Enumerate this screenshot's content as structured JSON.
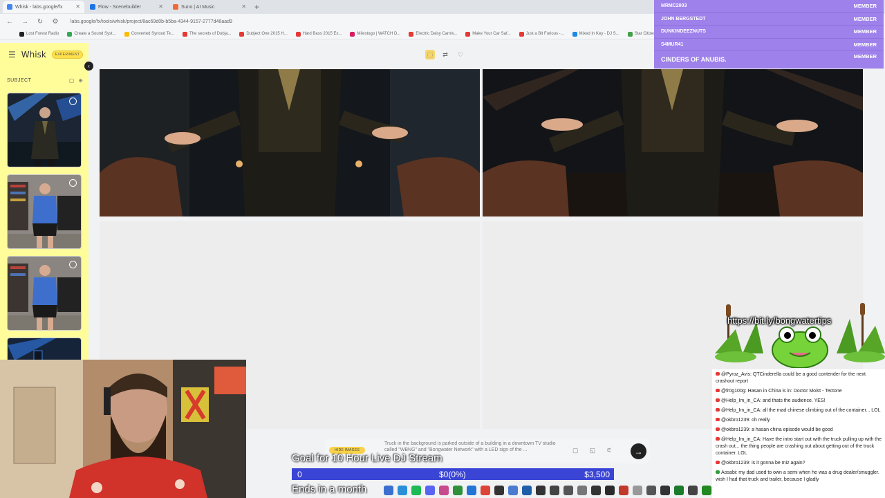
{
  "browser": {
    "tabs": [
      {
        "title": "Whisk - labs.google/fx",
        "color": "#4285f4",
        "active": true
      },
      {
        "title": "Flow - Scenebuilder",
        "color": "#1a73e8",
        "active": false
      },
      {
        "title": "Suno | AI Music",
        "color": "#f06a35",
        "active": false
      }
    ],
    "url": "labs.google/fx/tools/whisk/project/8ac69d0b-b5ba-4344-9157-2777d48aad9",
    "bookmarks": [
      {
        "label": "Lost Forest Radio",
        "color": "#222"
      },
      {
        "label": "Create a Sound Syst...",
        "color": "#34a853"
      },
      {
        "label": "Converted Synced Te...",
        "color": "#fbbc04"
      },
      {
        "label": "The secrets of Dubja...",
        "color": "#e53935"
      },
      {
        "label": "Dubject One 2015 H...",
        "color": "#e53935"
      },
      {
        "label": "Hard Bass 2015 Ex...",
        "color": "#e53935"
      },
      {
        "label": "Milestogo | WATCH D...",
        "color": "#d81b60"
      },
      {
        "label": "Electric Daisy Carniv...",
        "color": "#e53935"
      },
      {
        "label": "Make Your Car Saf...",
        "color": "#e53935"
      },
      {
        "label": "Just a Bit Furious -...",
        "color": "#e53935"
      },
      {
        "label": "Mixed In Key - DJ S...",
        "color": "#1e88e5"
      },
      {
        "label": "Star Citizen - Image...",
        "color": "#43a047"
      }
    ]
  },
  "whisk": {
    "logo": "Whisk",
    "badge": "EXPERIMENT",
    "subject_label": "SUBJECT"
  },
  "prompt": {
    "hide_images": "HIDE IMAGES",
    "text": "Truck in the background is parked outside of a building in a downtown TV studio called \"WBNG\" and \"Bongwater Network\" with a LED sign of the ..."
  },
  "goal": {
    "title": "Goal for 10 Hour Live DJ Stream",
    "start": "0",
    "progress": "$0(0%)",
    "target": "$3,500",
    "fraction": 0,
    "ends": "Ends in a month"
  },
  "members": [
    {
      "name": "MRMC2003",
      "tag": "MEMBER"
    },
    {
      "name": "JOHN BERGSTEDT",
      "tag": "MEMBER"
    },
    {
      "name": "DUNKINDEEZNUTS",
      "tag": "MEMBER"
    },
    {
      "name": "S4MUR41",
      "tag": "MEMBER"
    },
    {
      "name": "CINDERS OF ANUBIS.",
      "tag": "MEMBER"
    }
  ],
  "frog_url": "https://bit.ly/bongwatertips",
  "chat": [
    {
      "user": "@Pyroz_Avis",
      "text": "QTCinderella could be a good contender for the next crashout report",
      "badge": "red"
    },
    {
      "user": "@fr0g100g",
      "text": "Hasan in China is in: Doctor Moist - Tectone",
      "badge": "red"
    },
    {
      "user": "@Help_Im_in_CA",
      "text": "and thats the audience. YES!",
      "badge": "red"
    },
    {
      "user": "@Help_Im_in_CA",
      "text": "all the mad chinese climbing out of the container... LOL",
      "badge": "red"
    },
    {
      "user": "@okbro1239",
      "text": "oh really",
      "badge": "red"
    },
    {
      "user": "@okbro1239",
      "text": "a hasan china episode would be good",
      "badge": "red"
    },
    {
      "user": "@Help_Im_in_CA",
      "text": "Have the intro start out with the truck pulling up with the crash out... the thing people are crashing out about getting out of the truck container. LOL",
      "badge": "red"
    },
    {
      "user": "@okbro1239",
      "text": "is it gonna be miz again?",
      "badge": "red"
    },
    {
      "user": "Aosabi",
      "text": "my dad used to own a semi when he was a drug dealer/smuggler. wish I had that truck and trailer, because I gladly",
      "badge": "green"
    }
  ]
}
